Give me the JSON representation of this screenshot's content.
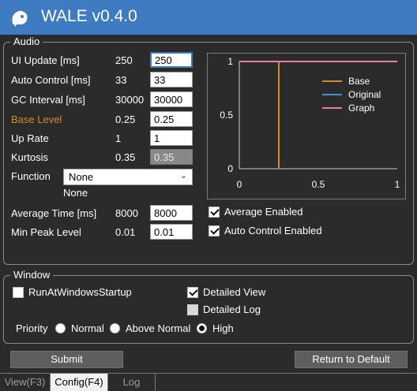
{
  "window": {
    "title": "WALE v0.4.0"
  },
  "audio": {
    "group_label": "Audio",
    "fields": [
      {
        "label": "UI Update [ms]",
        "value": "250",
        "input": "250"
      },
      {
        "label": "Auto Control [ms]",
        "value": "33",
        "input": "33"
      },
      {
        "label": "GC Interval [ms]",
        "value": "30000",
        "input": "30000"
      },
      {
        "label": "Base Level",
        "value": "0.25",
        "input": "0.25"
      },
      {
        "label": "Up Rate",
        "value": "1",
        "input": "1"
      },
      {
        "label": "Kurtosis",
        "value": "0.35",
        "input": "0.35"
      }
    ],
    "function_label": "Function",
    "function_selected": "None",
    "function_value": "None",
    "average_time_label": "Average Time [ms]",
    "average_time_value": "8000",
    "average_time_input": "8000",
    "min_peak_label": "Min Peak Level",
    "min_peak_value": "0.01",
    "min_peak_input": "0.01",
    "average_enabled_label": "Average Enabled",
    "auto_control_enabled_label": "Auto Control Enabled"
  },
  "chart_data": {
    "type": "line",
    "x_ticks": [
      "0",
      "0.5",
      "1"
    ],
    "y_ticks": [
      "0",
      "0.5",
      "1"
    ],
    "xlim": [
      0,
      1
    ],
    "ylim": [
      0,
      1
    ],
    "legend_position": "top-right",
    "series": [
      {
        "name": "Base",
        "color": "#d18a2c",
        "x": [
          0.25,
          0.25
        ],
        "y": [
          0,
          1
        ]
      },
      {
        "name": "Original",
        "color": "#4a90c8",
        "x": [
          0,
          1
        ],
        "y": [
          1,
          1
        ]
      },
      {
        "name": "Graph",
        "color": "#e87fa8",
        "x": [
          0,
          1
        ],
        "y": [
          1,
          1
        ]
      }
    ]
  },
  "window_group": {
    "group_label": "Window",
    "run_at_startup_label": "RunAtWindowsStartup",
    "detailed_view_label": "Detailed View",
    "detailed_log_label": "Detailed Log",
    "priority_label": "Priority",
    "priority_options": [
      "Normal",
      "Above Normal",
      "High"
    ]
  },
  "buttons": {
    "submit": "Submit",
    "return_default": "Return to Default"
  },
  "tabs": [
    "View(F3)",
    "Config(F4)",
    "Log"
  ],
  "colors": {
    "titlebar": "#3e7bc1",
    "background": "#2b2b2b",
    "accent_orange": "#d18a2c"
  }
}
